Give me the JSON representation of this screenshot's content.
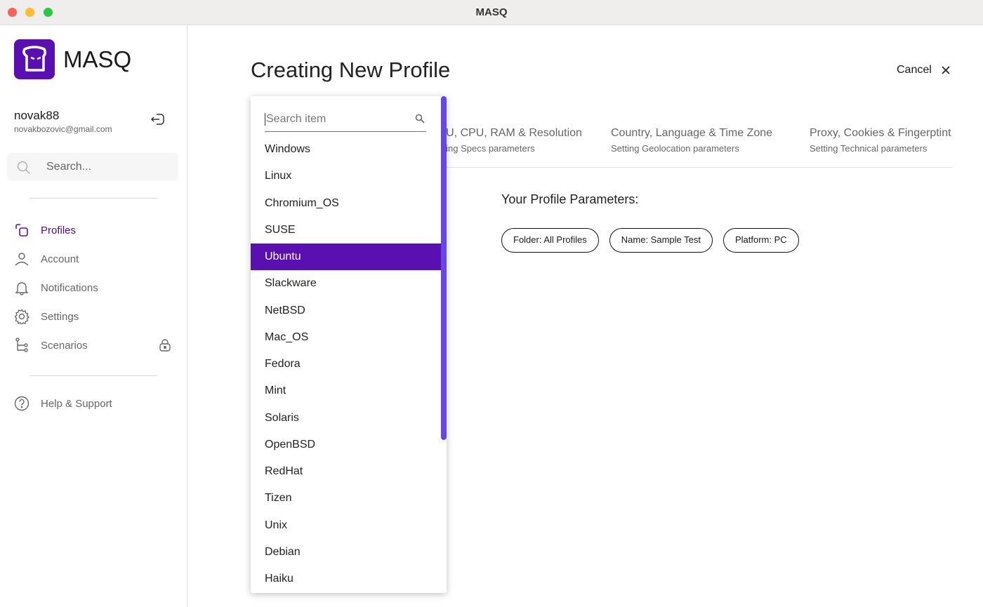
{
  "window": {
    "title": "MASQ"
  },
  "sidebar": {
    "brand": "MASQ",
    "user": {
      "name": "novak88",
      "email": "novakbozovic@gmail.com"
    },
    "search_placeholder": "Search...",
    "items": [
      {
        "label": "Profiles",
        "icon": "profiles-icon",
        "active": true
      },
      {
        "label": "Account",
        "icon": "user-icon"
      },
      {
        "label": "Notifications",
        "icon": "bell-icon"
      },
      {
        "label": "Settings",
        "icon": "gear-icon"
      },
      {
        "label": "Scenarios",
        "icon": "branch-icon",
        "locked": true
      }
    ],
    "help": "Help & Support"
  },
  "main": {
    "title": "Creating New Profile",
    "cancel": "Cancel",
    "tabs": [
      {
        "title": "GPU, CPU, RAM & Resolution",
        "subtitle": "Setting Specs parameters"
      },
      {
        "title": "Country, Language & Time Zone",
        "subtitle": "Setting Geolocation parameters"
      },
      {
        "title": "Proxy, Cookies & Fingerptint",
        "subtitle": "Setting Technical parameters"
      }
    ],
    "params_title": "Your Profile Parameters:",
    "chips": [
      "Folder: All Profiles",
      "Name: Sample Test",
      "Platform: PC"
    ]
  },
  "dropdown": {
    "placeholder": "Search item",
    "selected": "Ubuntu",
    "items": [
      "Windows",
      "Linux",
      "Chromium_OS",
      "SUSE",
      "Ubuntu",
      "Slackware",
      "NetBSD",
      "Mac_OS",
      "Fedora",
      "Mint",
      "Solaris",
      "OpenBSD",
      "RedHat",
      "Tizen",
      "Unix",
      "Debian",
      "Haiku"
    ]
  },
  "colors": {
    "accent": "#5a0fb0",
    "scrollbar": "#6647e6"
  }
}
